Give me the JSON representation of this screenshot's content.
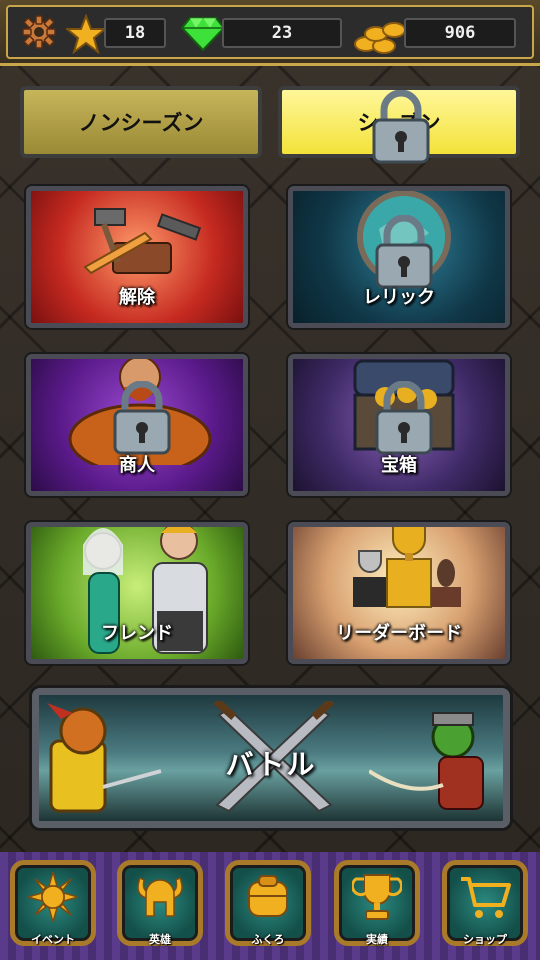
{
  "resources": {
    "stars": "18",
    "gems": "23",
    "coins": "906"
  },
  "mode_buttons": {
    "nonseason": "ノンシーズン",
    "season": "シーズン"
  },
  "tiles": {
    "remove": "解除",
    "relic": "レリック",
    "merchant": "商人",
    "treasure": "宝箱",
    "friend": "フレンド",
    "leaderboard": "リーダーボード"
  },
  "battle": {
    "label": "バトル"
  },
  "nav": {
    "event": "イベント",
    "hero": "英雄",
    "bag": "ふくろ",
    "achievement": "実績",
    "shop": "ショップ"
  },
  "colors": {
    "gold_accent": "#c9a64a",
    "season_yellow": "#f3e23a",
    "nonseason_olive": "#9a8a36"
  }
}
